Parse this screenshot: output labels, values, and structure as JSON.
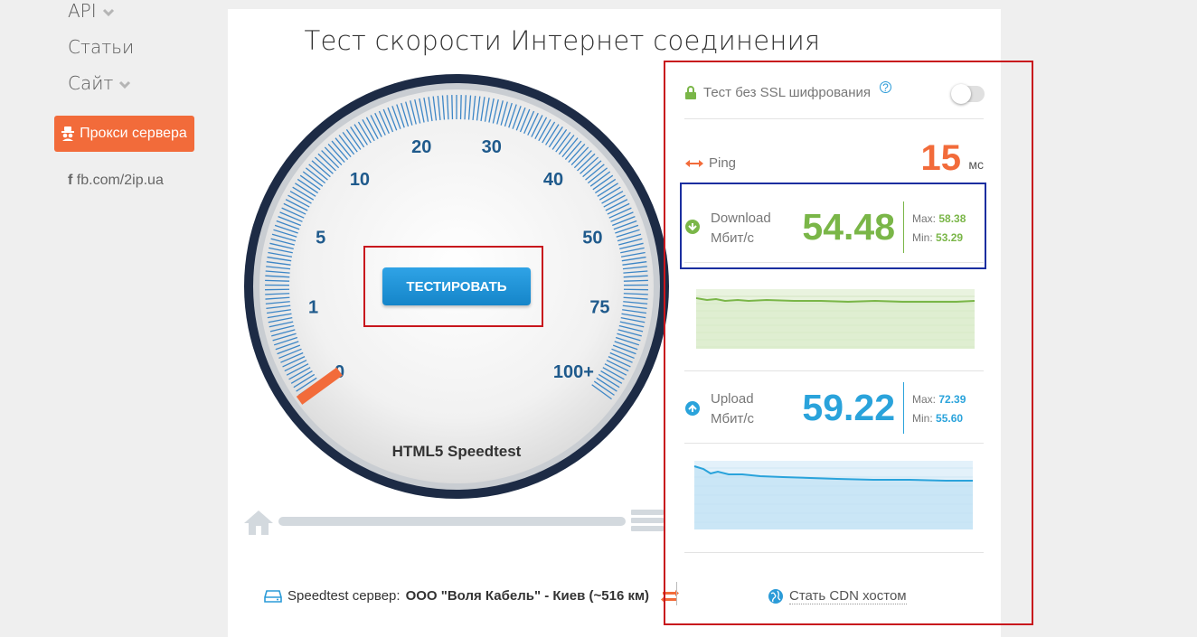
{
  "sidebar": {
    "items": [
      {
        "label": "API",
        "has_dropdown": true
      },
      {
        "label": "Статьи",
        "has_dropdown": false
      },
      {
        "label": "Сайт",
        "has_dropdown": true
      }
    ],
    "proxy_button": "Прокси сервера",
    "fb_link": "fb.com/2ip.ua"
  },
  "main": {
    "title": "Тест скорости Интернет соединения",
    "gauge": {
      "scale_labels": [
        "0",
        "1",
        "5",
        "10",
        "20",
        "30",
        "40",
        "50",
        "75",
        "100+"
      ],
      "caption": "HTML5 Speedtest",
      "needle_value": "0"
    },
    "test_button": "ТЕСТИРОВАТЬ",
    "server": {
      "label": "Speedtest сервер:",
      "name": "ООО \"Воля Кабель\" - Киев (~516 км)"
    }
  },
  "results": {
    "ssl_label": "Тест без SSL шифрования",
    "ssl_help": "?",
    "ssl_enabled": false,
    "ping": {
      "label": "Ping",
      "value": "15",
      "unit": "мс"
    },
    "download": {
      "label": "Download",
      "unit": "Мбит/с",
      "value": "54.48",
      "max_label": "Max:",
      "max": "58.38",
      "min_label": "Min:",
      "min": "53.29",
      "color": "#7ab648"
    },
    "upload": {
      "label": "Upload",
      "unit": "Мбит/с",
      "value": "59.22",
      "max_label": "Max:",
      "max": "72.39",
      "min_label": "Min:",
      "min": "55.60",
      "color": "#2aa3db"
    },
    "cdn_link": "Стать CDN хостом"
  },
  "colors": {
    "accent_orange": "#f26b3a",
    "button_blue": "#1e93d8",
    "gauge_ring": "#1d2b45",
    "tick_blue": "#3d86c6",
    "annotation_red": "#c8161d",
    "annotation_blue": "#1a2ea0"
  }
}
